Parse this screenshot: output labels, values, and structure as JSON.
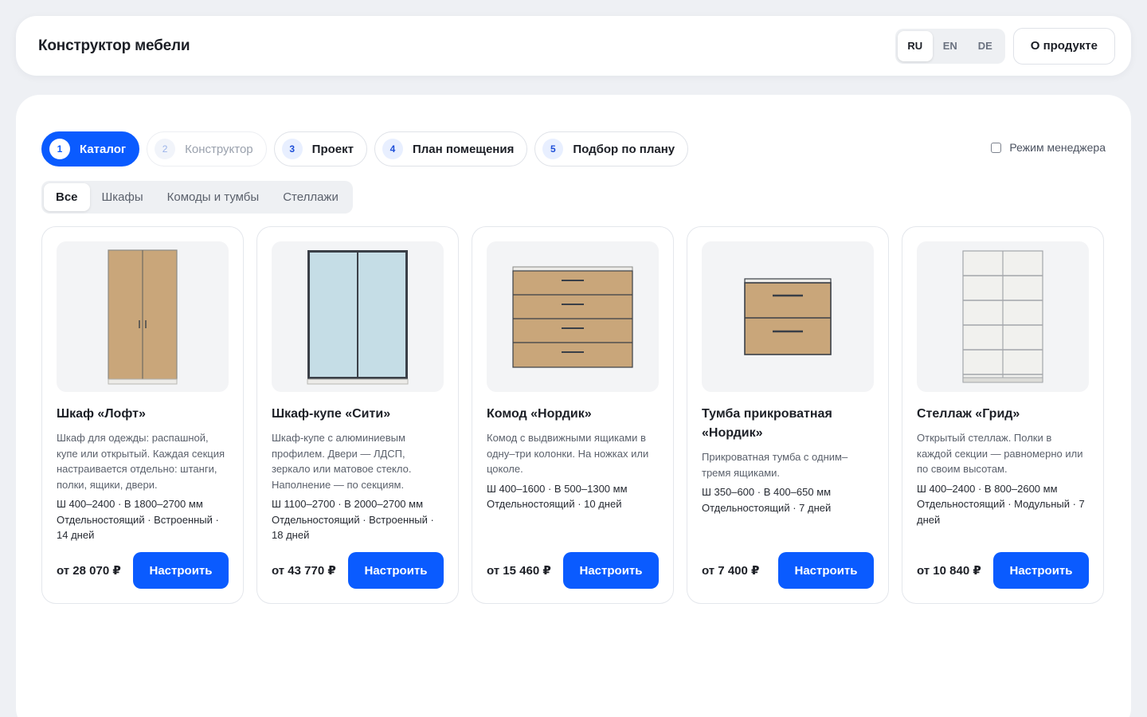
{
  "header": {
    "title": "Конструктор мебели",
    "languages": [
      "RU",
      "EN",
      "DE"
    ],
    "active_language": "RU",
    "about_label": "О продукте"
  },
  "steps": [
    {
      "num": "1",
      "label": "Каталог",
      "state": "active"
    },
    {
      "num": "2",
      "label": "Конструктор",
      "state": "disabled"
    },
    {
      "num": "3",
      "label": "Проект",
      "state": "normal"
    },
    {
      "num": "4",
      "label": "План помещения",
      "state": "normal"
    },
    {
      "num": "5",
      "label": "Подбор по плану",
      "state": "normal"
    }
  ],
  "manager_mode": {
    "label": "Режим менеджера",
    "checked": false
  },
  "filter_tabs": [
    "Все",
    "Шкафы",
    "Комоды и тумбы",
    "Стеллажи"
  ],
  "active_filter": "Все",
  "products": [
    {
      "image": "wardrobe-icon",
      "title": "Шкаф «Лофт»",
      "description": "Шкаф для одежды: распашной, купе или открытый. Каждая секция настраивается отдельно: штанги, полки, ящики, двери.",
      "dims": "Ш 400–2400 · В 1800–2700 мм",
      "meta": "Отдельностоящий · Встроенный · 14 дней",
      "price": "от 28 070 ₽",
      "button": "Настроить"
    },
    {
      "image": "sliding-wardrobe-icon",
      "title": "Шкаф-купе «Сити»",
      "description": "Шкаф-купе с алюминиевым профилем. Двери — ЛДСП, зеркало или матовое стекло. Наполнение — по секциям.",
      "dims": "Ш 1100–2700 · В 2000–2700 мм",
      "meta": "Отдельностоящий · Встроенный · 18 дней",
      "price": "от 43 770 ₽",
      "button": "Настроить"
    },
    {
      "image": "dresser-icon",
      "title": "Комод «Нордик»",
      "description": "Комод с выдвижными ящиками в одну–три колонки. На ножках или цоколе.",
      "dims": "Ш 400–1600 · В 500–1300 мм",
      "meta": "Отдельностоящий · 10 дней",
      "price": "от 15 460 ₽",
      "button": "Настроить"
    },
    {
      "image": "nightstand-icon",
      "title": "Тумба прикроватная «Нордик»",
      "description": "Прикроватная тумба с одним–тремя ящиками.",
      "dims": "Ш 350–600 · В 400–650 мм",
      "meta": "Отдельностоящий · 7 дней",
      "price": "от 7 400 ₽",
      "button": "Настроить"
    },
    {
      "image": "shelving-icon",
      "title": "Стеллаж «Грид»",
      "description": "Открытый стеллаж. Полки в каждой секции — равномерно или по своим высотам.",
      "dims": "Ш 400–2400 · В 800–2600 мм",
      "meta": "Отдельностоящий · Модульный · 7 дней",
      "price": "от 10 840 ₽",
      "button": "Настроить"
    }
  ],
  "colors": {
    "accent": "#0a5bff",
    "wood": "#c9a67a",
    "glass": "#c5dde6",
    "frame": "#3a3f47",
    "shelf": "#f1f1ee"
  }
}
